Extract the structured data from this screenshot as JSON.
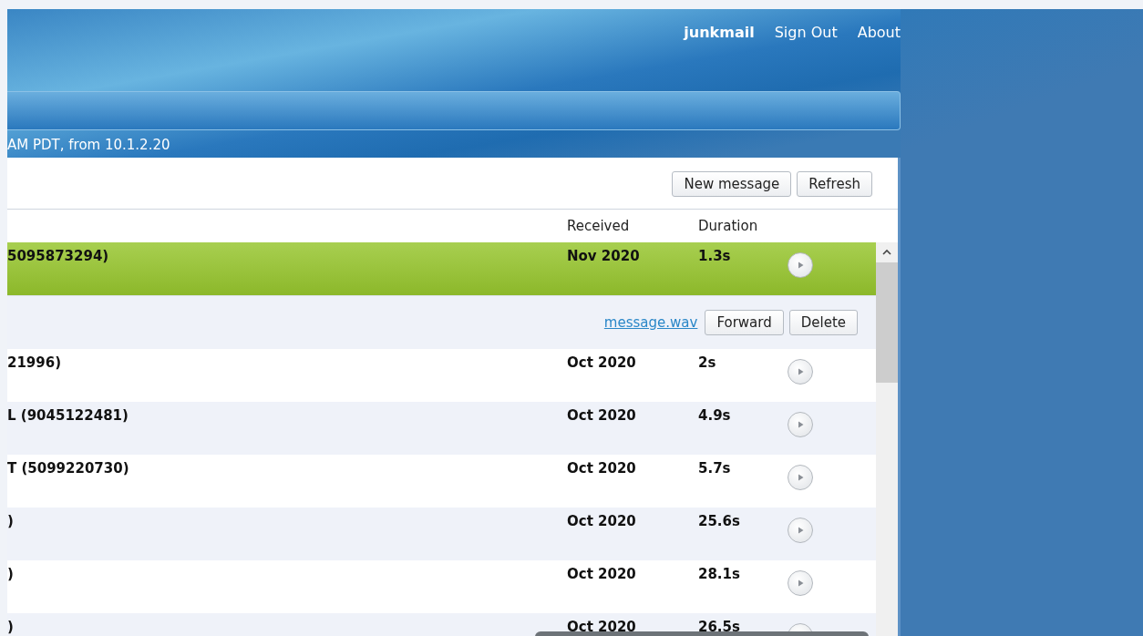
{
  "header": {
    "user": "junkmail",
    "links": [
      "Sign Out",
      "About"
    ]
  },
  "status": "AM PDT, from 10.1.2.20",
  "toolbar": {
    "buttons": [
      "New message",
      "Refresh"
    ]
  },
  "columns": [
    "Received",
    "Duration"
  ],
  "messages": [
    {
      "caller": "5095873294)",
      "received": "Nov 2020",
      "duration": "1.3s",
      "selected": true,
      "expanded": true,
      "attachment": "message.wav",
      "actions": [
        "Forward",
        "Delete"
      ]
    },
    {
      "caller": "21996)",
      "received": "Oct 2020",
      "duration": "2s",
      "selected": false,
      "expanded": false
    },
    {
      "caller": "L (9045122481)",
      "received": "Oct 2020",
      "duration": "4.9s",
      "selected": false,
      "expanded": false
    },
    {
      "caller": "T (5099220730)",
      "received": "Oct 2020",
      "duration": "5.7s",
      "selected": false,
      "expanded": false
    },
    {
      "caller": ")",
      "received": "Oct 2020",
      "duration": "25.6s",
      "selected": false,
      "expanded": false
    },
    {
      "caller": ")",
      "received": "Oct 2020",
      "duration": "28.1s",
      "selected": false,
      "expanded": false
    },
    {
      "caller": ")",
      "received": "Oct 2020",
      "duration": "26.5s",
      "selected": false,
      "expanded": false
    }
  ]
}
